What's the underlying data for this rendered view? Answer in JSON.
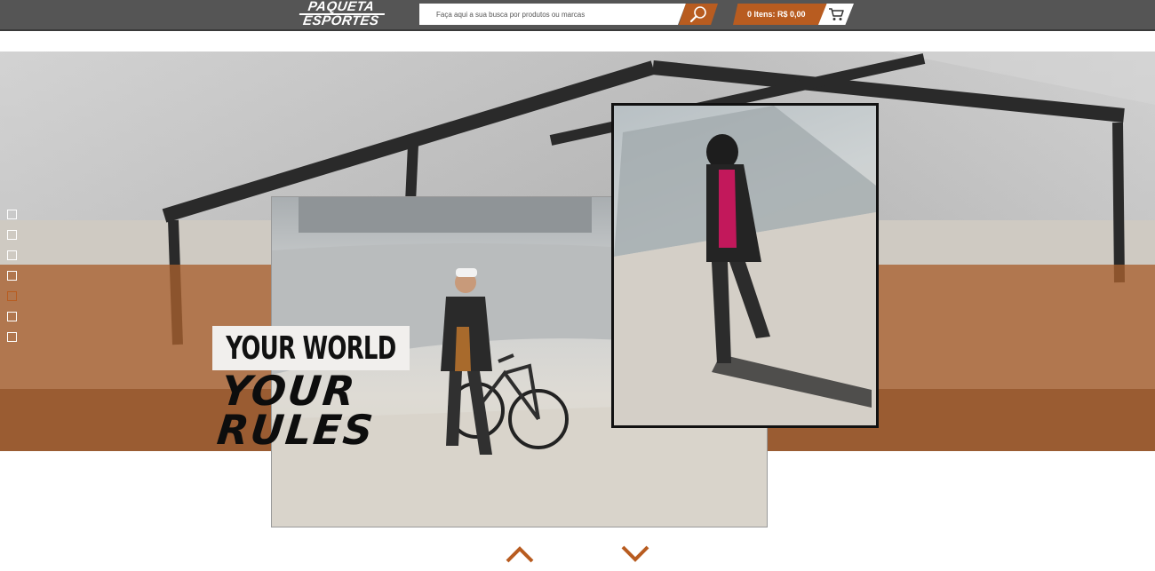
{
  "header": {
    "logo_line1": "PAQUETA",
    "logo_line2": "ESPORTES",
    "search_placeholder": "Faça aqui a sua busca por produtos ou marcas",
    "search_button_icon": "search-icon",
    "cart_summary": "0 Itens: R$ 0,00",
    "cart_icon": "cart-icon",
    "accent_color": "#b85c20"
  },
  "hero": {
    "headline": "YOUR WORLD",
    "tagline_line1": "YOUR",
    "tagline_line2": "RULES"
  },
  "slider": {
    "slide_count": 7,
    "active_index": 4
  },
  "nav": {
    "up_icon": "chevron-up-icon",
    "down_icon": "chevron-down-icon"
  }
}
